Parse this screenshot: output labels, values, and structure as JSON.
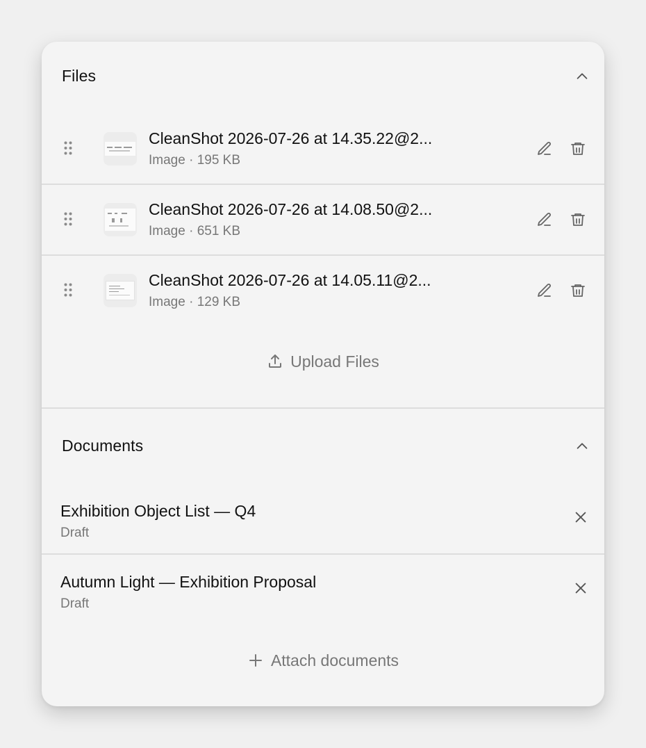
{
  "files_section": {
    "title": "Files",
    "items": [
      {
        "name": "CleanShot 2026-07-26 at 14.35.22@2...",
        "meta": "Image · 195 KB"
      },
      {
        "name": "CleanShot 2026-07-26 at 14.08.50@2...",
        "meta": "Image · 651 KB"
      },
      {
        "name": "CleanShot 2026-07-26 at 14.05.11@2...",
        "meta": "Image · 129 KB"
      }
    ],
    "upload_label": "Upload Files"
  },
  "documents_section": {
    "title": "Documents",
    "items": [
      {
        "title": "Exhibition Object List — Q4",
        "status": "Draft"
      },
      {
        "title": "Autumn Light — Exhibition Proposal",
        "status": "Draft"
      }
    ],
    "attach_label": "Attach documents"
  },
  "icons": {
    "collapse": "chevron-up-icon",
    "drag": "drag-handle-icon",
    "edit": "pencil-icon",
    "delete": "trash-icon",
    "upload": "upload-icon",
    "remove": "close-icon",
    "attach": "plus-icon"
  },
  "colors": {
    "page_background": "#f0f0f0",
    "card_background": "#f4f4f4",
    "divider": "#dddddd",
    "primary_text": "#111111",
    "secondary_text": "#777777"
  }
}
